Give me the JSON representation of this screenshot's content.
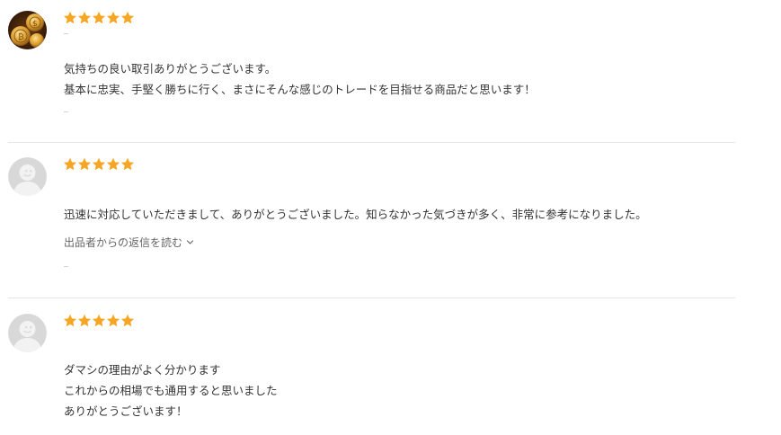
{
  "colors": {
    "star": "#f5a623",
    "text": "#333333",
    "muted": "#666666",
    "divider": "#e6e6e6",
    "avatar_placeholder_bg": "#d8d8d8",
    "avatar_placeholder_fg": "#f2f2f2"
  },
  "reviews": [
    {
      "avatar": "coin-photo-avatar",
      "rating": 5,
      "text": "気持ちの良い取引ありがとうございます。\n基本に忠実、手堅く勝ちに行く、まさにそんな感じのトレードを目指せる商品だと思います！"
    },
    {
      "avatar": "default-user-avatar",
      "rating": 5,
      "text": "迅速に対応していただきまして、ありがとうございました。知らなかった気づきが多く、非常に参考になりました。",
      "reply_link": "出品者からの返信を読む"
    },
    {
      "avatar": "default-user-avatar",
      "rating": 5,
      "text": "ダマシの理由がよく分かります\nこれからの相場でも通用すると思いました\nありがとうございます！"
    }
  ]
}
